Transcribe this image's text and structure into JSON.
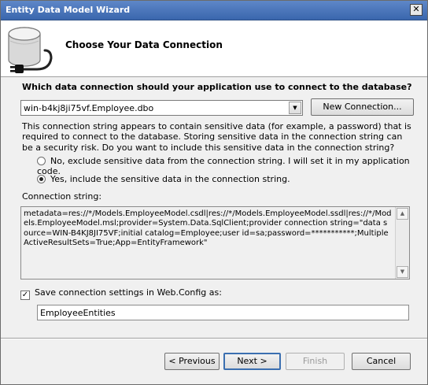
{
  "window": {
    "title": "Entity Data Model Wizard",
    "close_label": "✕"
  },
  "header": {
    "title": "Choose Your Data Connection"
  },
  "connection": {
    "question": "Which data connection should your application use to connect to the database?",
    "selected": "win-b4kj8ji75vf.Employee.dbo",
    "new_connection_label": "New Connection..."
  },
  "sensitive": {
    "warning": "This connection string appears to contain sensitive data (for example, a password) that is required to connect to the database. Storing sensitive data in the connection string can be a security risk. Do you want to include this sensitive data in the connection string?",
    "option_no": "No, exclude sensitive data from the connection string. I will set it in my application code.",
    "option_yes": "Yes, include the sensitive data in the connection string.",
    "selected_option": "yes"
  },
  "connection_string": {
    "label": "Connection string:",
    "value": "metadata=res://*/Models.EmployeeModel.csdl|res://*/Models.EmployeeModel.ssdl|res://*/Models.EmployeeModel.msl;provider=System.Data.SqlClient;provider connection string=\"data source=WIN-B4KJ8JI75VF;initial catalog=Employee;user id=sa;password=***********;MultipleActiveResultSets=True;App=EntityFramework\""
  },
  "save_settings": {
    "checked": true,
    "label": "Save connection settings in Web.Config as:",
    "value": "EmployeeEntities"
  },
  "buttons": {
    "previous": "< Previous",
    "next": "Next >",
    "finish": "Finish",
    "cancel": "Cancel"
  },
  "icons": [
    "database-icon",
    "plug-icon",
    "chevron-down-icon",
    "close-icon",
    "scroll-up-icon",
    "scroll-down-icon",
    "checkmark-icon"
  ]
}
